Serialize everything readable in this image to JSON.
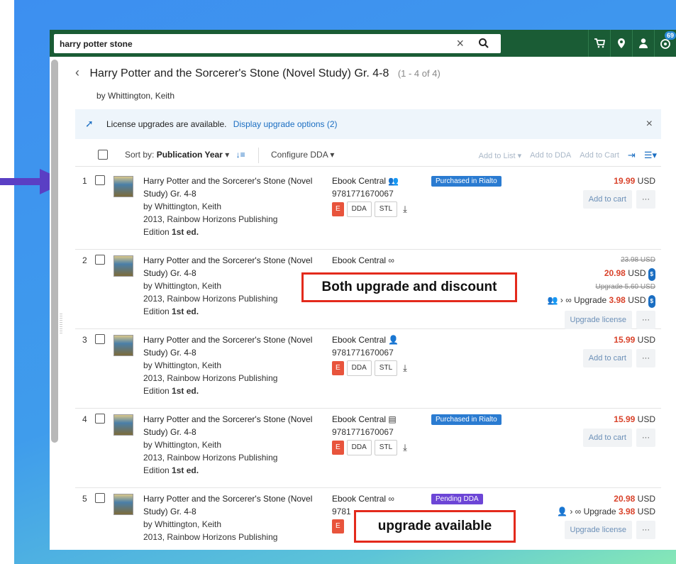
{
  "search": {
    "query": "harry potter stone"
  },
  "topbar": {
    "notif_count": "69"
  },
  "header": {
    "title": "Harry Potter and the Sorcerer's Stone (Novel Study) Gr. 4-8",
    "count": "(1 - 4 of 4)",
    "byline": "by Whittington, Keith"
  },
  "banner": {
    "text": "License upgrades are available.",
    "link": "Display upgrade options (2)"
  },
  "toolbar": {
    "sort_label": "Sort by:",
    "sort_value": "Publication Year",
    "configure": "Configure DDA",
    "add_list": "Add to List",
    "add_dda": "Add to DDA",
    "add_cart": "Add to Cart"
  },
  "rows": [
    {
      "num": "1",
      "title1": "Harry Potter and the Sorcerer's Stone (Novel",
      "title2": "Study) Gr. 4-8",
      "author": "by Whittington, Keith",
      "pub": "2013, Rainbow Horizons Publishing",
      "edition_label": "Edition",
      "edition": "1st ed.",
      "product": "Ebook Central",
      "isbn": "9781771670067",
      "status": "Purchased in Rialto",
      "price": "19.99",
      "currency": "USD",
      "action": "Add to cart"
    },
    {
      "num": "2",
      "title1": "Harry Potter and the Sorcerer's Stone (Novel",
      "title2": "Study) Gr. 4-8",
      "author": "by Whittington, Keith",
      "pub": "2013, Rainbow Horizons Publishing",
      "edition_label": "Edition",
      "edition": "1st ed.",
      "product": "Ebook Central",
      "old_price": "23.98 USD",
      "price": "20.98",
      "currency": "USD",
      "old_upgrade": "Upgrade 5.60 USD",
      "upgrade_label": "Upgrade",
      "upgrade_price": "3.98",
      "action": "Upgrade license"
    },
    {
      "num": "3",
      "title1": "Harry Potter and the Sorcerer's Stone (Novel",
      "title2": "Study) Gr. 4-8",
      "author": "by Whittington, Keith",
      "pub": "2013, Rainbow Horizons Publishing",
      "edition_label": "Edition",
      "edition": "1st ed.",
      "product": "Ebook Central",
      "isbn": "9781771670067",
      "price": "15.99",
      "currency": "USD",
      "action": "Add to cart"
    },
    {
      "num": "4",
      "title1": "Harry Potter and the Sorcerer's Stone (Novel",
      "title2": "Study) Gr. 4-8",
      "author": "by Whittington, Keith",
      "pub": "2013, Rainbow Horizons Publishing",
      "edition_label": "Edition",
      "edition": "1st ed.",
      "product": "Ebook Central",
      "isbn": "9781771670067",
      "status": "Purchased in Rialto",
      "price": "15.99",
      "currency": "USD",
      "action": "Add to cart"
    },
    {
      "num": "5",
      "title1": "Harry Potter and the Sorcerer's Stone (Novel",
      "title2": "Study) Gr. 4-8",
      "author": "by Whittington, Keith",
      "pub": "2013, Rainbow Horizons Publishing",
      "product": "Ebook Central",
      "isbn": "9781",
      "status": "Pending DDA",
      "price": "20.98",
      "currency": "USD",
      "upgrade_label": "Upgrade",
      "upgrade_price": "3.98",
      "action": "Upgrade license"
    }
  ],
  "license_tags": {
    "e": "E",
    "dda": "DDA",
    "stl": "STL"
  },
  "more": "···",
  "callouts": {
    "one": "Both upgrade and discount",
    "two": "upgrade available"
  },
  "colors": {
    "topbar": "#1a5c35",
    "price": "#d9432b",
    "link": "#1b6ec2",
    "callout_border": "#e32a1c",
    "arrow": "#5a3fc4"
  }
}
